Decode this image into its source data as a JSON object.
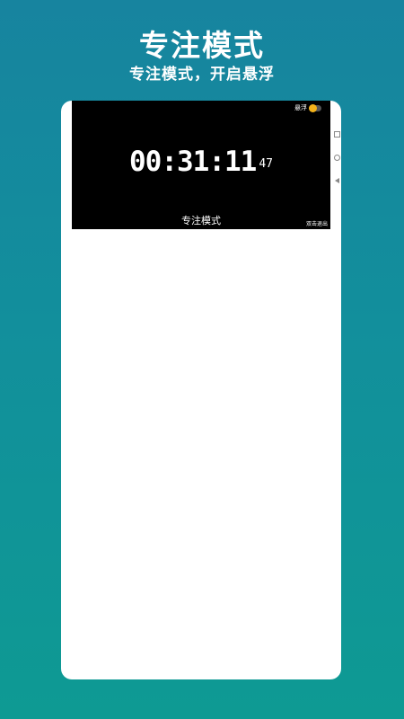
{
  "header": {
    "title": "专注模式",
    "subtitle": "专注模式，开启悬浮"
  },
  "screen": {
    "float_label": "悬浮",
    "float_toggle_on": true,
    "timer_main": "00:31:11",
    "timer_centis": "47",
    "mode_label": "专注模式",
    "exit_hint": "双击退出"
  },
  "colors": {
    "background_top": "#17849f",
    "background_bottom": "#0e9a93",
    "toggle_knob": "#f2b21b"
  },
  "nav_icons": [
    "recent-apps-icon",
    "home-icon",
    "back-icon"
  ]
}
